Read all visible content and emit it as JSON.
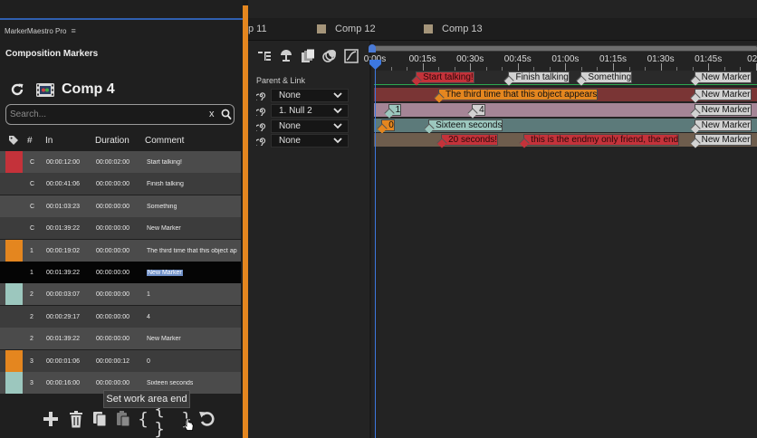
{
  "plugin": {
    "panel_title": "MarkerMaestro Pro",
    "panel_menu_icon": "≡",
    "section_title": "Composition Markers",
    "comp_name": "Comp 4",
    "search": {
      "placeholder": "Search...",
      "clear": "x"
    },
    "columns": {
      "number": "#",
      "in": "In",
      "duration": "Duration",
      "comment": "Comment"
    },
    "rows": [
      {
        "swatch": "#c4323a",
        "label": "C",
        "in": "00:00:12:00",
        "duration": "00:00:02:00",
        "comment": "Start talking!"
      },
      {
        "swatch": "",
        "label": "C",
        "in": "00:00:41:06",
        "duration": "00:00:00:00",
        "comment": "Finish talking"
      },
      {
        "swatch": "",
        "label": "C",
        "in": "00:01:03:23",
        "duration": "00:00:00:00",
        "comment": "Something"
      },
      {
        "swatch": "",
        "label": "C",
        "in": "00:01:39:22",
        "duration": "00:00:00:00",
        "comment": "New Marker"
      },
      {
        "swatch": "#e4861f",
        "label": "1",
        "in": "00:00:19:02",
        "duration": "00:00:00:00",
        "comment": "The third time that this object ap"
      },
      {
        "swatch": "",
        "label": "1",
        "in": "00:01:39:22",
        "duration": "00:00:00:00",
        "comment": "New Marker",
        "selected": true
      },
      {
        "swatch": "#9cc7be",
        "label": "2",
        "in": "00:00:03:07",
        "duration": "00:00:00:00",
        "comment": "1"
      },
      {
        "swatch": "",
        "label": "2",
        "in": "00:00:29:17",
        "duration": "00:00:00:00",
        "comment": "4"
      },
      {
        "swatch": "",
        "label": "2",
        "in": "00:01:39:22",
        "duration": "00:00:00:00",
        "comment": "New Marker"
      },
      {
        "swatch": "#e4861f",
        "label": "3",
        "in": "00:00:01:06",
        "duration": "00:00:00:12",
        "comment": "0"
      },
      {
        "swatch": "#9cc7be",
        "label": "3",
        "in": "00:00:16:00",
        "duration": "00:00:00:00",
        "comment": "Sixteen seconds"
      }
    ],
    "tooltip": "Set work area end",
    "toolbar": {
      "work_start": "{",
      "work_both": "{ }",
      "work_end": "}"
    }
  },
  "timeline": {
    "tabs": [
      "p 11",
      "Comp 12",
      "Comp 13"
    ],
    "parent_link_label": "Parent & Link",
    "layers": [
      {
        "parent": "None"
      },
      {
        "parent": "1. Null 2"
      },
      {
        "parent": "None"
      },
      {
        "parent": "None"
      }
    ],
    "ruler_labels": [
      "0:00s",
      "00:15s",
      "00:30s",
      "00:45s",
      "01:00s",
      "01:15s",
      "01:30s",
      "01:45s",
      "02:0"
    ],
    "comp_markers": [
      {
        "label": "Start talking!",
        "time_s": 12,
        "color": "#c4323a",
        "duration_s": 2
      },
      {
        "label": "Finish talking",
        "time_s": 41.2,
        "color": "#d2d2d2"
      },
      {
        "label": "Something",
        "time_s": 64,
        "color": "#d2d2d2"
      },
      {
        "label": "New Marker",
        "time_s": 99.7,
        "color": "#d2d2d2"
      }
    ],
    "layer_markers": [
      [
        {
          "label": "The third time that this object appears",
          "time_s": 19.1,
          "color": "#e4861f"
        },
        {
          "label": "New Marker",
          "time_s": 99.7,
          "color": "#d2d2d2"
        }
      ],
      [
        {
          "label": "1",
          "time_s": 3.3,
          "color": "#9cc7be"
        },
        {
          "label": "4",
          "time_s": 29.7,
          "color": "#d2d2d2"
        },
        {
          "label": "New Marker",
          "time_s": 99.7,
          "color": "#d2d2d2"
        }
      ],
      [
        {
          "label": "0",
          "time_s": 1.2,
          "color": "#e4861f"
        },
        {
          "label": "Sixteen seconds",
          "time_s": 16,
          "color": "#9cc7be"
        },
        {
          "label": "New Marker",
          "time_s": 99.7,
          "color": "#d2d2d2"
        }
      ],
      [
        {
          "label": "20 seconds!",
          "time_s": 20,
          "color": "#c4323a"
        },
        {
          "label": "this is the endmy only friend, the end",
          "time_s": 46,
          "color": "#c4323a"
        },
        {
          "label": "New Marker",
          "time_s": 99.7,
          "color": "#d2d2d2"
        }
      ]
    ],
    "track_colors": [
      "#7a3535",
      "#a58596",
      "#5c7a7a",
      "#6e5d4d"
    ],
    "playhead_time": "0:00s",
    "accent": "#e4861f",
    "playhead_color": "#3d78e0",
    "work_area_color": "#2fa84f"
  }
}
